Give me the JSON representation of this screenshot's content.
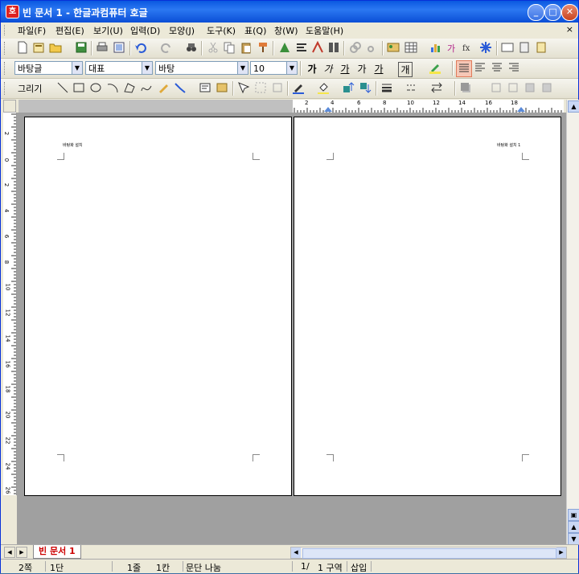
{
  "window": {
    "title": "빈 문서 1 - 한글과컴퓨터 호글",
    "app_icon": "호",
    "minimize": "_",
    "maximize": "□",
    "close": "✕"
  },
  "menu": {
    "items": [
      "파일(F)",
      "편집(E)",
      "보기(U)",
      "입력(D)",
      "모양(J)",
      "도구(K)",
      "표(Q)",
      "창(W)",
      "도움말(H)"
    ],
    "close_glyph": "×"
  },
  "format_toolbar": {
    "style_value": "바탕글",
    "font_lang_value": "대표",
    "font_value": "바탕",
    "size_value": "10",
    "text_buttons": [
      "가",
      "가",
      "가",
      "가",
      "가",
      "개"
    ]
  },
  "draw_toolbar": {
    "label": "그리기"
  },
  "ruler": {
    "h_numbers": [
      "2",
      "4",
      "6",
      "8",
      "10",
      "12",
      "14",
      "16",
      "18"
    ],
    "v_numbers": [
      "2",
      "0",
      "2",
      "4",
      "6",
      "8",
      "10",
      "12",
      "14",
      "16",
      "18",
      "20",
      "22",
      "24",
      "26"
    ]
  },
  "pages": [
    {
      "header_text": "바탕화 설치"
    },
    {
      "header_text": "바탕화 설치 1"
    }
  ],
  "doc_tab": {
    "label": "빈 문서 1"
  },
  "status_bar": {
    "page": "2쪽",
    "section": "1단",
    "line": "1줄",
    "column": "1칸",
    "break_type": "문단 나눔",
    "page_frac": "1/",
    "zone": "1 구역",
    "mode": "삽입"
  },
  "icons": {
    "new": "new-document-icon",
    "open": "open-folder-icon",
    "save": "save-icon",
    "print": "print-icon",
    "undo": "undo-icon",
    "find": "binoculars-icon"
  }
}
